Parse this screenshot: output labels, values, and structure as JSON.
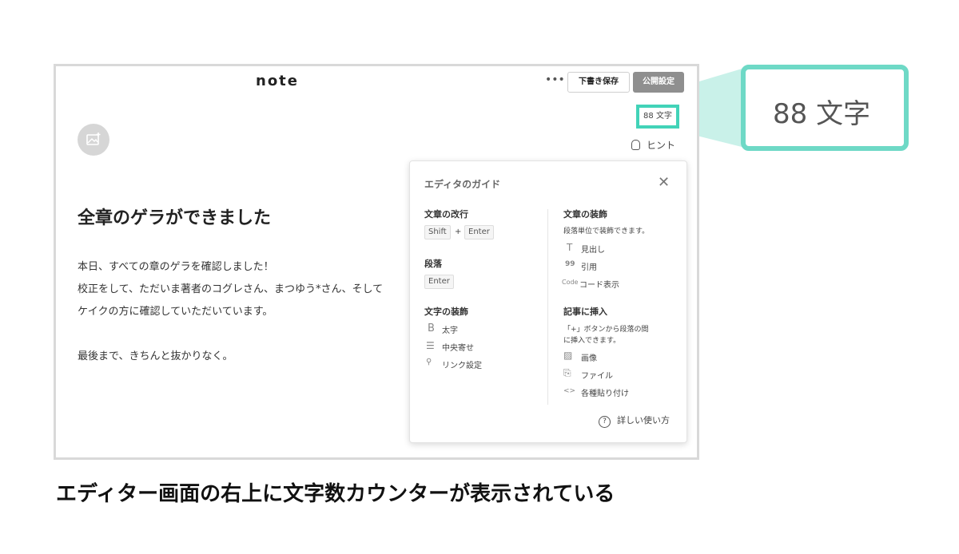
{
  "header": {
    "logo": "note",
    "more_label": "•••",
    "draft_button": "下書き保存",
    "publish_button": "公開設定"
  },
  "counter": {
    "text": "88 文字"
  },
  "hint": {
    "label": "ヒント"
  },
  "article": {
    "title": "全章のゲラができました",
    "paragraph_lines": [
      "本日、すべての章のゲラを確認しました！",
      "校正をして、ただいま著者のコグレさん、まつゆう*さん、そして",
      "ケイクの方に確認していただいています。",
      "最後まで、きちんと抜かりなく。"
    ]
  },
  "guide": {
    "title": "エディタのガイド",
    "close": "✕",
    "left": {
      "linebreak_heading": "文章の改行",
      "key_shift": "Shift",
      "plus": "+",
      "key_enter": "Enter",
      "paragraph_heading": "段落",
      "key_enter2": "Enter",
      "decoration_heading": "文字の装飾",
      "bold_icon": "B",
      "bold_label": "太字",
      "center_icon": "☰",
      "center_label": "中央寄せ",
      "link_icon": "🔗",
      "link_label": "リンク設定"
    },
    "right": {
      "text_decoration_heading": "文章の装飾",
      "text_decoration_desc": "段落単位で装飾できます。",
      "heading_icon": "T",
      "heading_label": "見出し",
      "quote_icon": "99",
      "quote_label": "引用",
      "code_icon": "Code",
      "code_label": "コード表示",
      "insert_heading": "記事に挿入",
      "insert_desc_1": "「+」ボタンから段落の間",
      "insert_desc_2": "に挿入できます。",
      "image_icon": "▨",
      "image_label": "画像",
      "file_icon": "⎘",
      "file_label": "ファイル",
      "embed_icon": "<>",
      "embed_label": "各種貼り付け"
    },
    "help_icon": "?",
    "help_label": "詳しい使い方"
  },
  "zoom": {
    "text": "88 文字"
  },
  "caption": "エディター画面の右上に文字数カウンターが表示されている",
  "colors": {
    "accent": "#42d3b8",
    "accent_light": "#6ed9c6",
    "publish_bg": "#8f8f8f"
  }
}
